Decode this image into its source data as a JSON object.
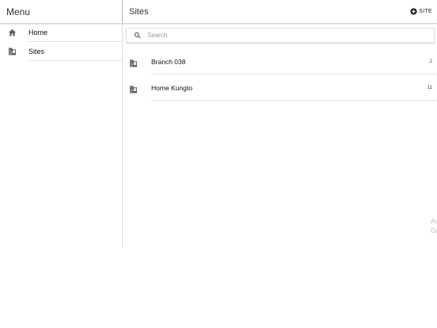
{
  "sidebar": {
    "title": "Menu",
    "items": [
      {
        "label": "Home",
        "icon": "home-icon"
      },
      {
        "label": "Sites",
        "icon": "building-icon"
      }
    ]
  },
  "main": {
    "title": "Sites",
    "add_button_label": "SITE",
    "add_button_icon": "add-circle-icon",
    "search_placeholder": "Search",
    "sites": [
      {
        "name": "Branch 038",
        "count": "2"
      },
      {
        "name": "Home Kungto",
        "count": "11"
      }
    ],
    "corner_lines": [
      "Ac",
      "Go"
    ]
  },
  "colors": {
    "divider": "#e4e4e4",
    "icon": "#5f5f5f",
    "placeholder": "#9a9a9a"
  }
}
